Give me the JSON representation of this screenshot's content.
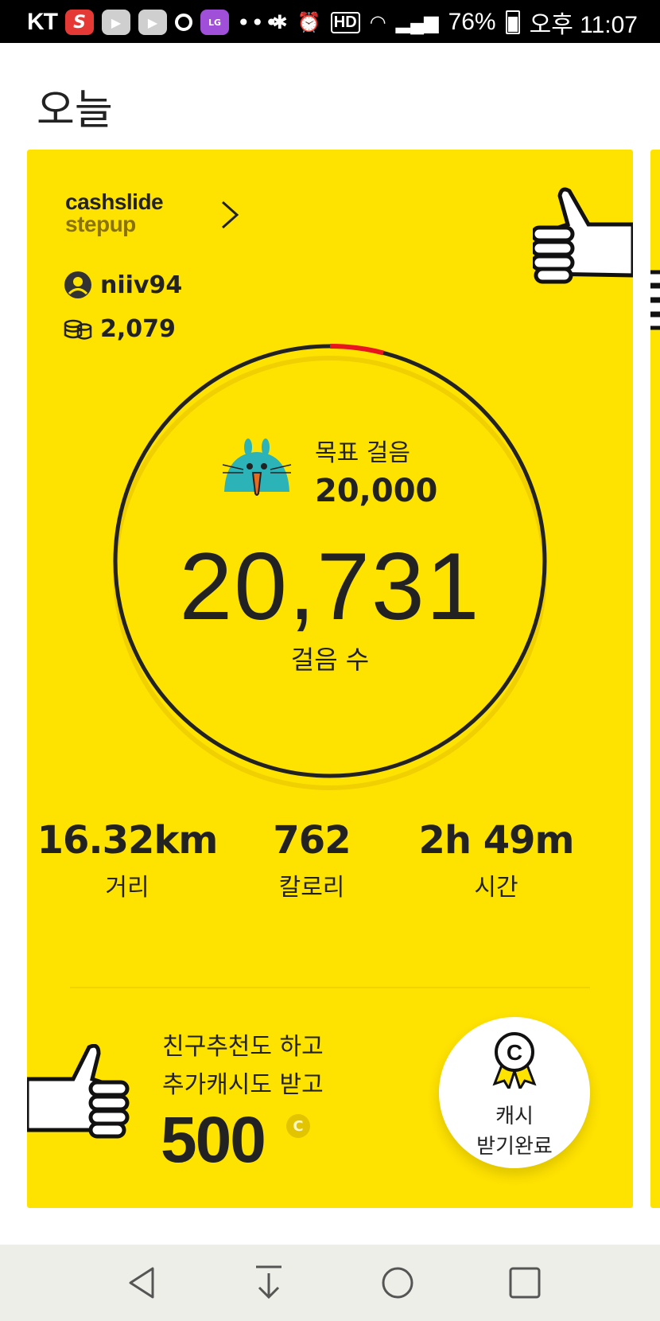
{
  "status_bar": {
    "carrier": "KT",
    "lg_badge": "LG",
    "more": "•••",
    "battery": "76%",
    "time": "오후 11:07",
    "hd": "HD"
  },
  "page": {
    "title": "오늘"
  },
  "card": {
    "brand_line1": "cashslide",
    "brand_line2": "stepup",
    "username": "niiv94",
    "coins": "2,079",
    "goal_label": "목표 걸음",
    "goal_value": "20,000",
    "steps_value": "20,731",
    "steps_label": "걸음 수",
    "progress_fraction": 1.0,
    "stats": [
      {
        "value": "16.32km",
        "label": "거리"
      },
      {
        "value": "762",
        "label": "칼로리"
      },
      {
        "value": "2h 49m",
        "label": "시간"
      }
    ],
    "promo_line1": "친구추천도 하고",
    "promo_line2": "추가캐시도 받고",
    "promo_amount": "500",
    "promo_coin_symbol": "C",
    "cash_button_line1": "캐시",
    "cash_button_line2": "받기완료"
  },
  "colors": {
    "card_bg": "#ffe300",
    "ring": "#222222",
    "ring_accent": "#e8141e",
    "mascot": "#2bb3b8"
  },
  "icons": {
    "nav": [
      "back-icon",
      "download-icon",
      "home-icon",
      "recent-apps-icon"
    ]
  }
}
